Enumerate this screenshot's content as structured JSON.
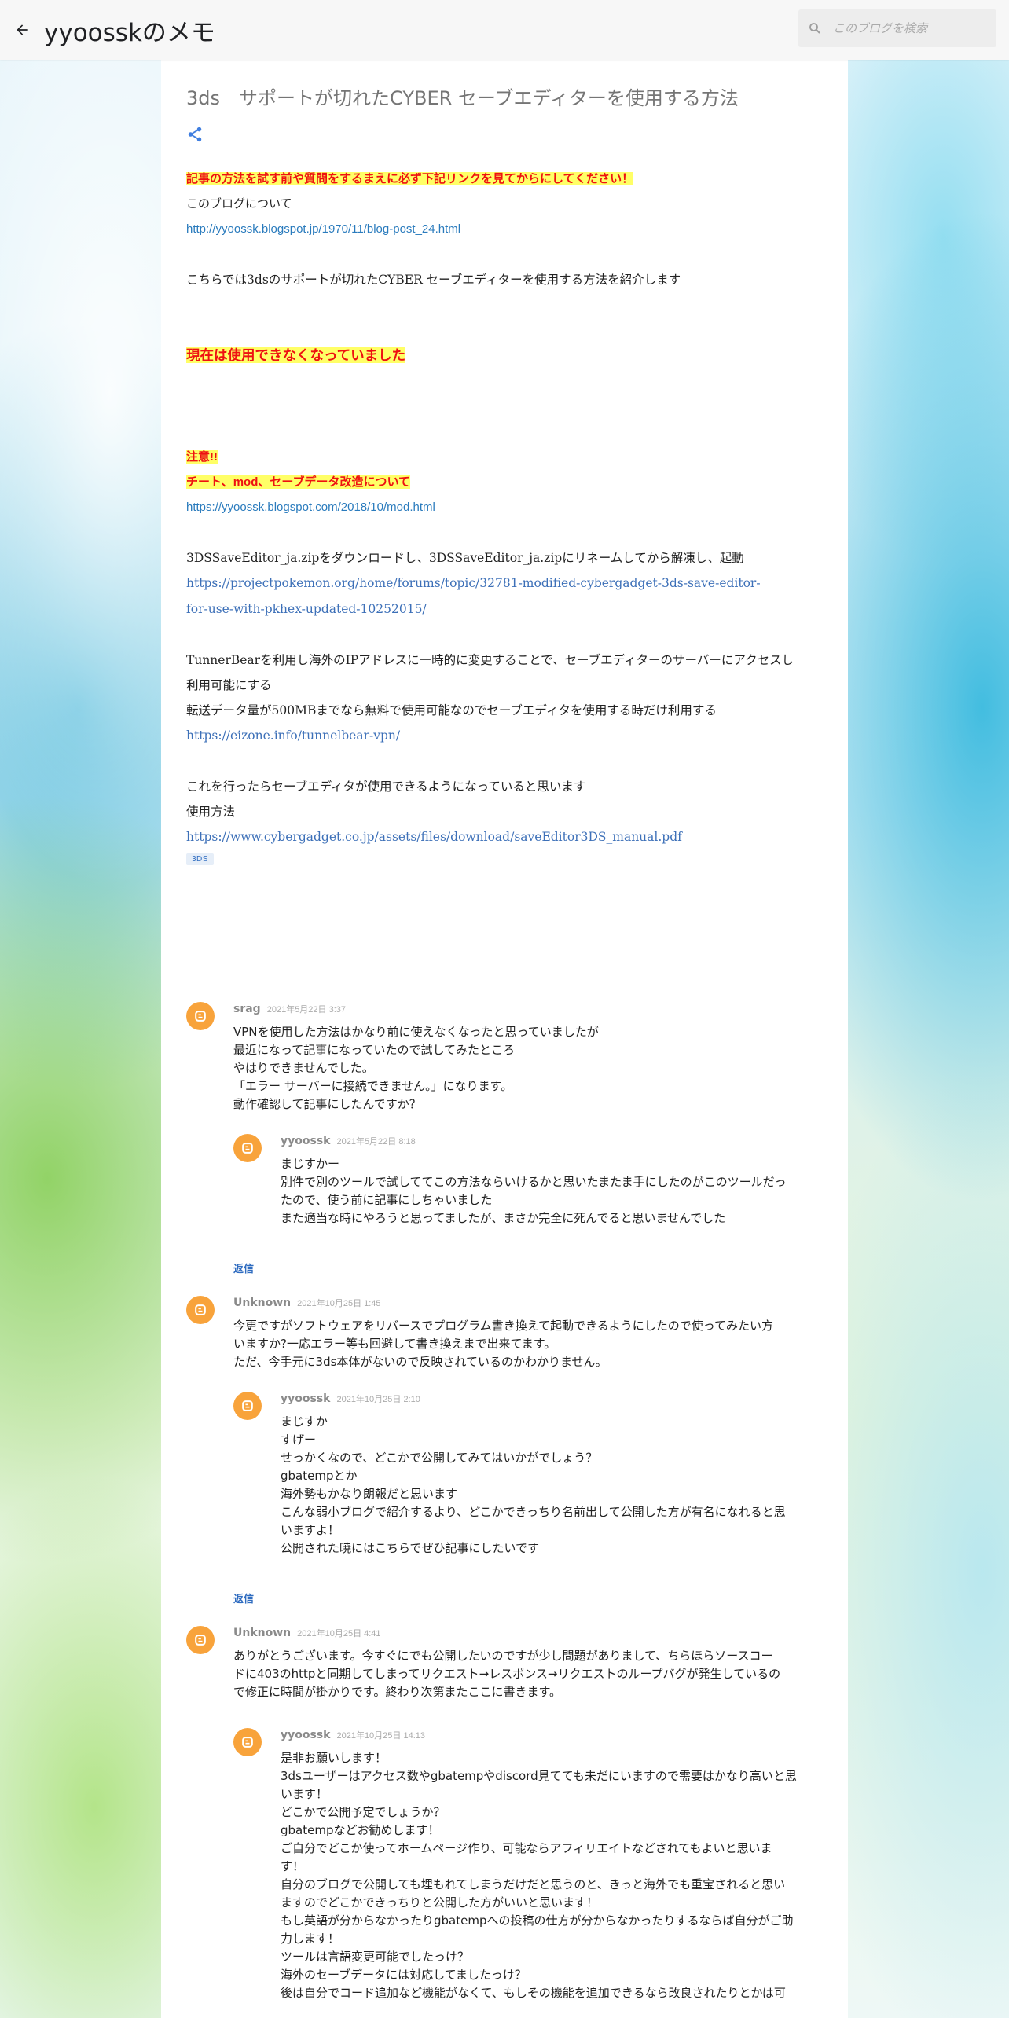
{
  "header": {
    "blog_title": "yyoosskのメモ",
    "search_placeholder": "このブログを検索"
  },
  "post": {
    "title": "3ds　サポートが切れたCYBER セーブエディターを使用する方法",
    "notice": "記事の方法を試す前や質問をするまえに必ず下記リンクを見てからにしてください！",
    "about_label": "このブログについて",
    "about_link": "http://yyoossk.blogspot.jp/1970/11/blog-post_24.html",
    "intro": "こちらでは3dsのサポートが切れたCYBER セーブエディターを使用する方法を紹介します",
    "unavailable": "現在は使用できなくなっていました",
    "caution": "注意!!",
    "caution_sub": "チート、mod、セーブデータ改造について",
    "caution_link": "https://yyoossk.blogspot.com/2018/10/mod.html",
    "download_text": "3DSSaveEditor_ja.zipをダウンロードし、3DSSaveEditor_ja.zipにリネームしてから解凍し、起動",
    "download_link_1": "https://projectpokemon.org/home/forums/topic/32781-modified-cybergadget-3ds-save-editor-",
    "download_link_2": "for-use-with-pkhex-updated-10252015/",
    "vpn_text_1": "TunnerBearを利用し海外のIPアドレスに一時的に変更することで、セーブエディターのサーバーにアクセスし",
    "vpn_text_2": "利用可能にする",
    "vpn_text_3": "転送データ量が500MBまでなら無料で使用可能なのでセーブエディタを使用する時だけ利用する",
    "vpn_link": "https://eizone.info/tunnelbear-vpn/",
    "result_text": "これを行ったらセーブエディタが使用できるようになっていると思います",
    "usage_label": "使用方法",
    "manual_link": "https://www.cybergadget.co.jp/assets/files/download/saveEditor3DS_manual.pdf",
    "tag": "3DS"
  },
  "comments": [
    {
      "author": "srag",
      "time": "2021年5月22日 3:37",
      "lines": [
        "VPNを使用した方法はかなり前に使えなくなったと思っていましたが",
        "最近になって記事になっていたので試してみたところ",
        "やはりできませんでした。",
        "「エラー サーバーに接続できません。」になります。",
        "動作確認して記事にしたんですか？"
      ],
      "reply": {
        "author": "yyoossk",
        "time": "2021年5月22日 8:18",
        "lines": [
          "まじすかー",
          "別件で別のツールで試しててこの方法ならいけるかと思いたまたま手にしたのがこのツールだっ",
          "たので、使う前に記事にしちゃいました",
          "また適当な時にやろうと思ってましたが、まさか完全に死んでると思いませんでした"
        ]
      },
      "reply_label": "返信"
    },
    {
      "author": "Unknown",
      "time": "2021年10月25日 1:45",
      "lines": [
        "今更ですがソフトウェアをリバースでプログラム書き換えて起動できるようにしたので使ってみたい方",
        "いますか?一応エラー等も回避して書き換えまで出来てます。",
        "ただ、今手元に3ds本体がないので反映されているのかわかりません。"
      ],
      "reply": {
        "author": "yyoossk",
        "time": "2021年10月25日 2:10",
        "lines": [
          "まじすか",
          "すげー",
          "せっかくなので、どこかで公開してみてはいかがでしょう？",
          "gbatempとか",
          "海外勢もかなり朗報だと思います",
          "こんな弱小ブログで紹介するより、どこかできっちり名前出して公開した方が有名になれると思",
          "いますよ！",
          "公開された暁にはこちらでぜひ記事にしたいです"
        ]
      },
      "reply_label": "返信"
    },
    {
      "author": "Unknown",
      "time": "2021年10月25日 4:41",
      "lines": [
        "ありがとうございます。今すぐにでも公開したいのですが少し問題がありまして、ちらほらソースコー",
        "ドに403のhttpと同期してしまってリクエスト→レスポンス→リクエストのループバグが発生しているの",
        "で修正に時間が掛かりです。終わり次第またここに書きます。"
      ],
      "reply": {
        "author": "yyoossk",
        "time": "2021年10月25日 14:13",
        "lines": [
          "是非お願いします！",
          "3dsユーザーはアクセス数やgbatempやdiscord見てても未だにいますので需要はかなり高いと思",
          "います！",
          "どこかで公開予定でしょうか？",
          "gbatempなどお勧めします！",
          "ご自分でどこか使ってホームページ作り、可能ならアフィリエイトなどされてもよいと思いま",
          "す！",
          "自分のブログで公開しても埋もれてしまうだけだと思うのと、きっと海外でも重宝されると思い",
          "ますのでどこかできっちりと公開した方がいいと思います！",
          "もし英語が分からなかったりgbatempへの投稿の仕方が分からなかったりするならば自分がご助",
          "力します！",
          "ツールは言語変更可能でしたっけ？",
          "海外のセーブデータには対応してましたっけ？",
          "後は自分でコード追加など機能がなくて、もしその機能を追加できるなら改良されたりとかは可"
        ]
      }
    }
  ]
}
